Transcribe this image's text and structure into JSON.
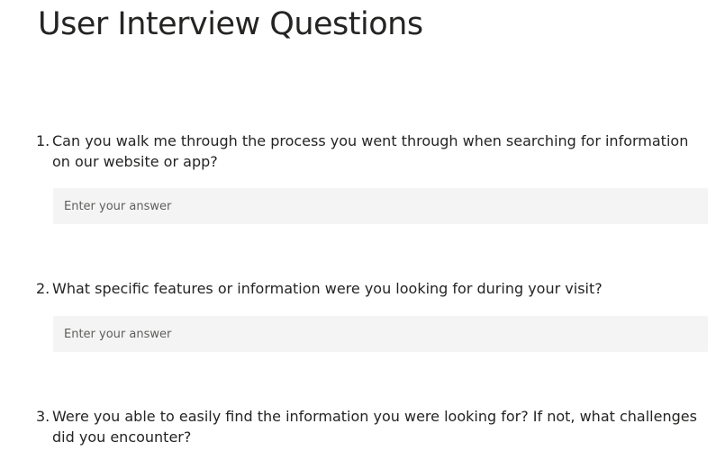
{
  "form": {
    "title": "User Interview Questions",
    "questions": [
      {
        "number": "1.",
        "text": "Can you walk me through the process you went through when searching for information on our website or app?",
        "answer": {
          "value": "",
          "placeholder": "Enter your answer"
        }
      },
      {
        "number": "2.",
        "text": "What specific features or information were you looking for during your visit?",
        "answer": {
          "value": "",
          "placeholder": "Enter your answer"
        }
      },
      {
        "number": "3.",
        "text": "Were you able to easily find the information you were looking for? If not, what challenges did you encounter?"
      }
    ]
  }
}
